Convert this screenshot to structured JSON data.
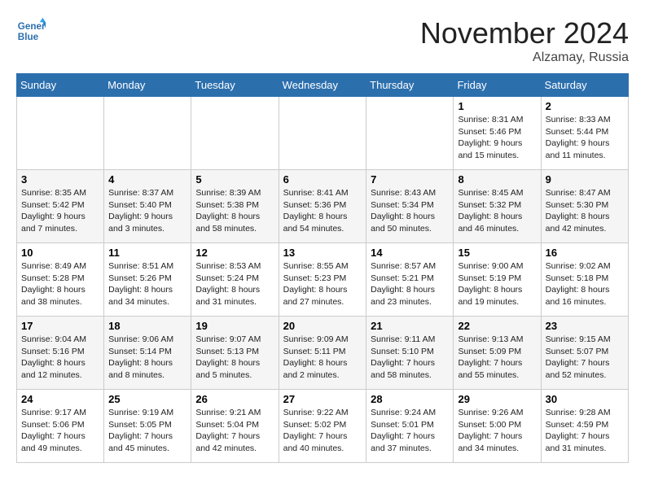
{
  "header": {
    "logo_line1": "General",
    "logo_line2": "Blue",
    "month_title": "November 2024",
    "location": "Alzamay, Russia"
  },
  "days_of_week": [
    "Sunday",
    "Monday",
    "Tuesday",
    "Wednesday",
    "Thursday",
    "Friday",
    "Saturday"
  ],
  "weeks": [
    [
      {
        "day": "",
        "info": ""
      },
      {
        "day": "",
        "info": ""
      },
      {
        "day": "",
        "info": ""
      },
      {
        "day": "",
        "info": ""
      },
      {
        "day": "",
        "info": ""
      },
      {
        "day": "1",
        "info": "Sunrise: 8:31 AM\nSunset: 5:46 PM\nDaylight: 9 hours and 15 minutes."
      },
      {
        "day": "2",
        "info": "Sunrise: 8:33 AM\nSunset: 5:44 PM\nDaylight: 9 hours and 11 minutes."
      }
    ],
    [
      {
        "day": "3",
        "info": "Sunrise: 8:35 AM\nSunset: 5:42 PM\nDaylight: 9 hours and 7 minutes."
      },
      {
        "day": "4",
        "info": "Sunrise: 8:37 AM\nSunset: 5:40 PM\nDaylight: 9 hours and 3 minutes."
      },
      {
        "day": "5",
        "info": "Sunrise: 8:39 AM\nSunset: 5:38 PM\nDaylight: 8 hours and 58 minutes."
      },
      {
        "day": "6",
        "info": "Sunrise: 8:41 AM\nSunset: 5:36 PM\nDaylight: 8 hours and 54 minutes."
      },
      {
        "day": "7",
        "info": "Sunrise: 8:43 AM\nSunset: 5:34 PM\nDaylight: 8 hours and 50 minutes."
      },
      {
        "day": "8",
        "info": "Sunrise: 8:45 AM\nSunset: 5:32 PM\nDaylight: 8 hours and 46 minutes."
      },
      {
        "day": "9",
        "info": "Sunrise: 8:47 AM\nSunset: 5:30 PM\nDaylight: 8 hours and 42 minutes."
      }
    ],
    [
      {
        "day": "10",
        "info": "Sunrise: 8:49 AM\nSunset: 5:28 PM\nDaylight: 8 hours and 38 minutes."
      },
      {
        "day": "11",
        "info": "Sunrise: 8:51 AM\nSunset: 5:26 PM\nDaylight: 8 hours and 34 minutes."
      },
      {
        "day": "12",
        "info": "Sunrise: 8:53 AM\nSunset: 5:24 PM\nDaylight: 8 hours and 31 minutes."
      },
      {
        "day": "13",
        "info": "Sunrise: 8:55 AM\nSunset: 5:23 PM\nDaylight: 8 hours and 27 minutes."
      },
      {
        "day": "14",
        "info": "Sunrise: 8:57 AM\nSunset: 5:21 PM\nDaylight: 8 hours and 23 minutes."
      },
      {
        "day": "15",
        "info": "Sunrise: 9:00 AM\nSunset: 5:19 PM\nDaylight: 8 hours and 19 minutes."
      },
      {
        "day": "16",
        "info": "Sunrise: 9:02 AM\nSunset: 5:18 PM\nDaylight: 8 hours and 16 minutes."
      }
    ],
    [
      {
        "day": "17",
        "info": "Sunrise: 9:04 AM\nSunset: 5:16 PM\nDaylight: 8 hours and 12 minutes."
      },
      {
        "day": "18",
        "info": "Sunrise: 9:06 AM\nSunset: 5:14 PM\nDaylight: 8 hours and 8 minutes."
      },
      {
        "day": "19",
        "info": "Sunrise: 9:07 AM\nSunset: 5:13 PM\nDaylight: 8 hours and 5 minutes."
      },
      {
        "day": "20",
        "info": "Sunrise: 9:09 AM\nSunset: 5:11 PM\nDaylight: 8 hours and 2 minutes."
      },
      {
        "day": "21",
        "info": "Sunrise: 9:11 AM\nSunset: 5:10 PM\nDaylight: 7 hours and 58 minutes."
      },
      {
        "day": "22",
        "info": "Sunrise: 9:13 AM\nSunset: 5:09 PM\nDaylight: 7 hours and 55 minutes."
      },
      {
        "day": "23",
        "info": "Sunrise: 9:15 AM\nSunset: 5:07 PM\nDaylight: 7 hours and 52 minutes."
      }
    ],
    [
      {
        "day": "24",
        "info": "Sunrise: 9:17 AM\nSunset: 5:06 PM\nDaylight: 7 hours and 49 minutes."
      },
      {
        "day": "25",
        "info": "Sunrise: 9:19 AM\nSunset: 5:05 PM\nDaylight: 7 hours and 45 minutes."
      },
      {
        "day": "26",
        "info": "Sunrise: 9:21 AM\nSunset: 5:04 PM\nDaylight: 7 hours and 42 minutes."
      },
      {
        "day": "27",
        "info": "Sunrise: 9:22 AM\nSunset: 5:02 PM\nDaylight: 7 hours and 40 minutes."
      },
      {
        "day": "28",
        "info": "Sunrise: 9:24 AM\nSunset: 5:01 PM\nDaylight: 7 hours and 37 minutes."
      },
      {
        "day": "29",
        "info": "Sunrise: 9:26 AM\nSunset: 5:00 PM\nDaylight: 7 hours and 34 minutes."
      },
      {
        "day": "30",
        "info": "Sunrise: 9:28 AM\nSunset: 4:59 PM\nDaylight: 7 hours and 31 minutes."
      }
    ]
  ]
}
